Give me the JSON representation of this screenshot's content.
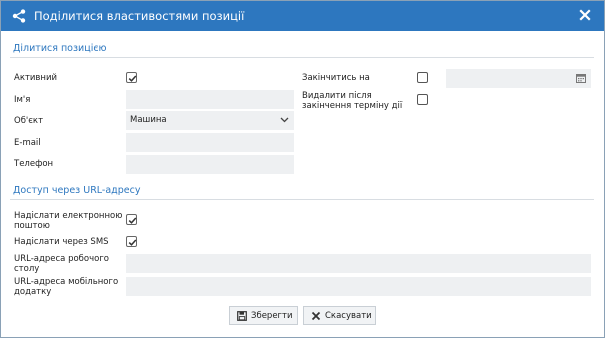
{
  "dialog": {
    "title": "Поділитися властивостями позиції",
    "share_icon": "share-icon",
    "close_icon": "close-icon",
    "accent_color": "#2d77bf"
  },
  "share_section": {
    "heading": "Ділитися позицією",
    "active_label": "Активний",
    "active_checked": true,
    "name_label": "Ім'я",
    "name_value": "",
    "object_label": "Об'єкт",
    "object_value": "Машина",
    "email_label": "E-mail",
    "email_value": "",
    "phone_label": "Телефон",
    "phone_value": "",
    "expire_label": "Закінчитись на",
    "expire_checked": false,
    "expire_date_value": "",
    "delete_after_label_line1": "Видалити після",
    "delete_after_label_line2": "закінчення терміну дії",
    "delete_after_checked": false
  },
  "url_section": {
    "heading": "Доступ через URL-адресу",
    "send_email_label_line1": "Надіслати електронною",
    "send_email_label_line2": "поштою",
    "send_email_checked": true,
    "send_sms_label": "Надіслати через SMS",
    "send_sms_checked": true,
    "desktop_url_label_line1": "URL-адреса робочого",
    "desktop_url_label_line2": "столу",
    "desktop_url_value": "",
    "mobile_url_label_line1": "URL-адреса мобільного",
    "mobile_url_label_line2": "додатку",
    "mobile_url_value": ""
  },
  "footer": {
    "save_label": "Зберегти",
    "save_icon": "save-icon",
    "cancel_label": "Скасувати",
    "cancel_icon": "cancel-x-icon"
  }
}
